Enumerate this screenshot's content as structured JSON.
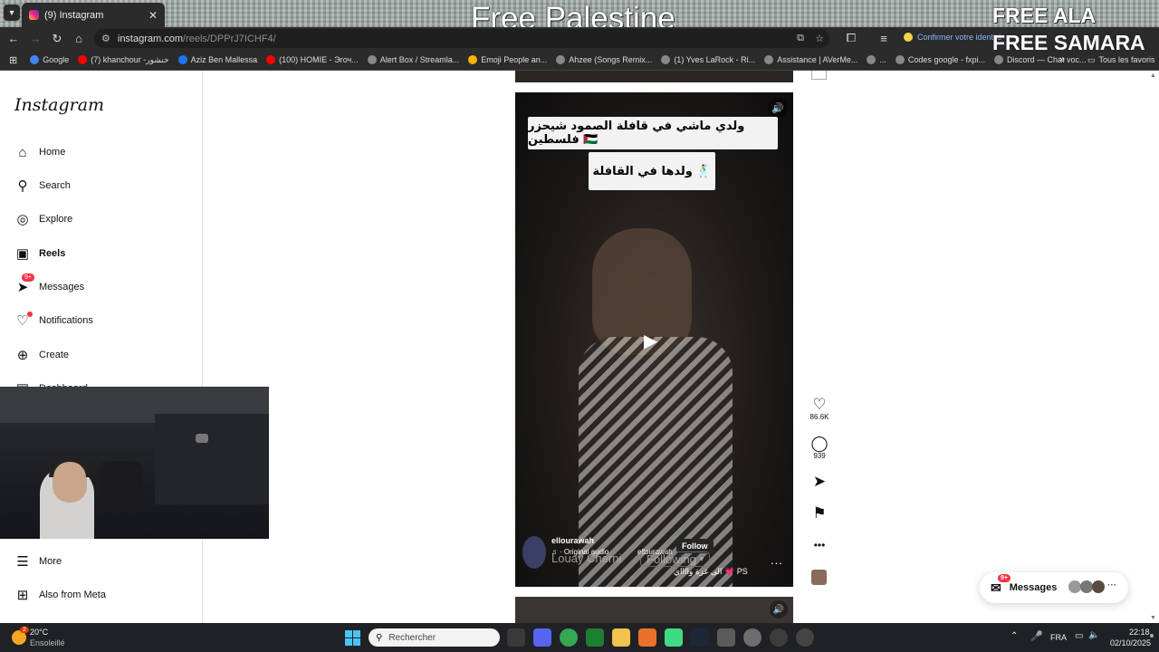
{
  "browser": {
    "tab_title": "(9) Instagram",
    "tab_badge": "9",
    "url_host": "instagram.com",
    "url_path": "/reels/DPPrJ7ICHF4/",
    "identity_notice": "Confirmer votre identité"
  },
  "overlay": {
    "main": "Free Palestine",
    "right_line1": "FREE ALA",
    "right_line2": "FREE SAMARA"
  },
  "bookmarks": [
    {
      "label": "Google",
      "color": "#4285f4"
    },
    {
      "label": "(7) khanchour -خنشور",
      "color": "#ff0000"
    },
    {
      "label": "Aziz Ben Mallessa",
      "color": "#1877f2"
    },
    {
      "label": "(100) HOMIE - Эгоч...",
      "color": "#ff0000"
    },
    {
      "label": "Alert Box / Streamla...",
      "color": "#888888"
    },
    {
      "label": "Emoji People an...",
      "color": "#f4b400"
    },
    {
      "label": "Ahzee (Songs Remix...",
      "color": "#888888"
    },
    {
      "label": "(1) Yves LaRock - Ri...",
      "color": "#888888"
    },
    {
      "label": "Assistance | AVerMe...",
      "color": "#888888"
    },
    {
      "label": "...",
      "color": "#888888"
    },
    {
      "label": "Codes google - fxpi...",
      "color": "#888888"
    },
    {
      "label": "Discord — Chat voc...",
      "color": "#888888"
    }
  ],
  "bookmarks_more": "»",
  "bookmarks_all": "Tous les favoris",
  "sidebar": {
    "logo": "Instagram",
    "items": [
      {
        "label": "Home",
        "icon": "home-icon"
      },
      {
        "label": "Search",
        "icon": "search-icon"
      },
      {
        "label": "Explore",
        "icon": "explore-icon"
      },
      {
        "label": "Reels",
        "icon": "reels-icon"
      },
      {
        "label": "Messages",
        "icon": "messages-icon",
        "badge": "9+"
      },
      {
        "label": "Notifications",
        "icon": "heart-icon"
      },
      {
        "label": "Create",
        "icon": "plus-icon"
      },
      {
        "label": "Dashboard",
        "icon": "dashboard-icon"
      }
    ],
    "more": "More",
    "meta": "Also from Meta"
  },
  "reel": {
    "caption_line1": "ولدي ماشي في قافلة الصمود شيحزر فلسطين 🇵🇸",
    "caption_line2": "ولدها في القافلة 🕺",
    "username": "ellourawah",
    "audio": "· Original audio",
    "follow_label": "Follow",
    "overlay_name": "Louay Cherni",
    "overlay_following": "Following",
    "overlay_user": "ellourawah",
    "arabic_caption": "الى غزة وااااي 💗 PS",
    "more": "..."
  },
  "actions": {
    "likes": "86.6K",
    "comments": "939"
  },
  "messages_pill": {
    "label": "Messages",
    "badge": "9+",
    "more": "···"
  },
  "taskbar": {
    "temp": "20°C",
    "weather": "Ensoleillé",
    "weather_badge": "2",
    "search_placeholder": "Rechercher",
    "lang": "FRA",
    "time": "22:18",
    "date": "02/10/2025"
  }
}
